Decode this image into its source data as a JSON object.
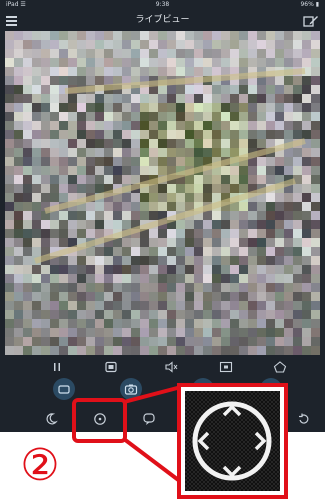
{
  "status_bar": {
    "carrier": "iPad ☰",
    "time": "9:38",
    "battery": "96% ▮"
  },
  "header": {
    "title": "ライブビュー",
    "menu_icon": "hamburger-menu-icon",
    "edit_icon": "edit-icon"
  },
  "live_view": {
    "description_icon": "camera-feed"
  },
  "toolbar_primary": {
    "items": [
      {
        "icon": "pause-icon"
      },
      {
        "icon": "screenshot-icon"
      },
      {
        "icon": "speaker-mute-icon"
      },
      {
        "icon": "hd-quality-icon"
      },
      {
        "icon": "fullscreen-icon"
      }
    ]
  },
  "toolbar_secondary": {
    "items": [
      {
        "icon": "record-icon"
      },
      {
        "icon": "snapshot-camera-icon"
      },
      {
        "icon": "microphone-icon"
      },
      {
        "icon": "alarm-icon"
      }
    ]
  },
  "toolbar_tertiary": {
    "items": [
      {
        "icon": "moon-night-icon"
      },
      {
        "icon": "ptz-direction-icon"
      },
      {
        "icon": "chat-icon"
      },
      {
        "icon": "rotate-icon"
      }
    ]
  },
  "annotation": {
    "step_number": "②",
    "highlight_color": "#e01019"
  }
}
